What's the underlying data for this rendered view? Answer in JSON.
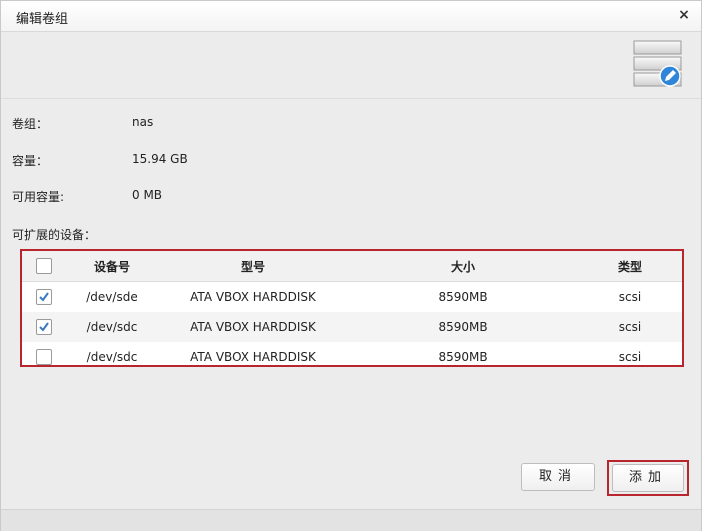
{
  "dialog": {
    "title": "编辑卷组",
    "close_label": "×"
  },
  "info": [
    {
      "label": "卷组：",
      "value": "nas"
    },
    {
      "label": "容量：",
      "value": "15.94 GB"
    },
    {
      "label": "可用容量:",
      "value": "0 MB"
    }
  ],
  "devices_label": "可扩展的设备：",
  "table": {
    "headers": [
      "设备号",
      "型号",
      "大小",
      "类型"
    ],
    "rows": [
      {
        "device": "/dev/sde",
        "model": "ATA VBOX HARDDISK",
        "size": "8590MB",
        "type": "scsi",
        "checked": true
      },
      {
        "device": "/dev/sdc",
        "model": "ATA VBOX HARDDISK",
        "size": "8590MB",
        "type": "scsi",
        "checked": true
      },
      {
        "device": "/dev/sdc",
        "model": "ATA VBOX HARDDISK",
        "size": "8590MB",
        "type": "scsi",
        "checked": false
      }
    ]
  },
  "buttons": {
    "cancel": "取消",
    "add": "添加"
  },
  "colors": {
    "highlight": "#b8262d",
    "check": "#3a7ac0",
    "icon_badge": "#2f86d8"
  },
  "icons": {
    "volume": "volume-edit-icon",
    "check": "checkmark-icon"
  }
}
